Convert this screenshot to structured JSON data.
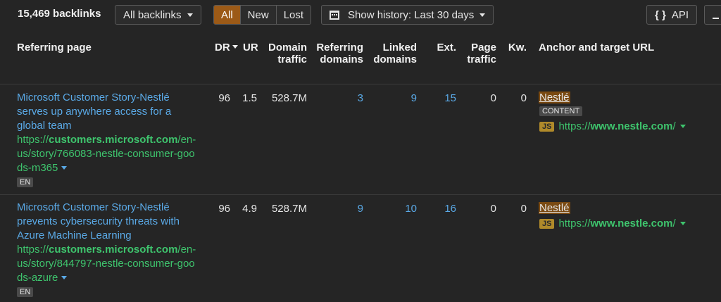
{
  "toolbar": {
    "count": "15,469 backlinks",
    "filter_label": "All backlinks",
    "seg_all": "All",
    "seg_new": "New",
    "seg_lost": "Lost",
    "history_label": "Show history: Last 30 days",
    "api_label": "API"
  },
  "header": {
    "referring_page": "Referring page",
    "dr": "DR",
    "ur": "UR",
    "domain_traffic_1": "Domain",
    "domain_traffic_2": "traffic",
    "ref_domains_1": "Referring",
    "ref_domains_2": "domains",
    "linked_domains_1": "Linked",
    "linked_domains_2": "domains",
    "ext": "Ext.",
    "page_traffic_1": "Page",
    "page_traffic_2": "traffic",
    "kw": "Kw.",
    "anchor": "Anchor and target URL"
  },
  "rows": [
    {
      "title_l1": "Microsoft Customer Story-Nestlé",
      "title_l2": "serves up anywhere access for a",
      "title_l3": "global team",
      "url_prefix": "https://",
      "url_domain": "customers.microsoft.com",
      "url_rest_l1": "/en-",
      "url_l2": "us/story/766083-nestle-consumer-goo",
      "url_l3": "ds-m365",
      "lang": "EN",
      "dr": "96",
      "ur": "1.5",
      "domain_traffic": "528.7M",
      "ref_domains": "3",
      "linked_domains": "9",
      "ext": "15",
      "page_traffic": "0",
      "kw": "0",
      "anchor": "Nestlé",
      "content_tag": "CONTENT",
      "js": "JS",
      "target_prefix": "https://",
      "target_domain": "www.nestle.com",
      "target_suffix": "/"
    },
    {
      "title_l1": "Microsoft Customer Story-Nestlé",
      "title_l2": "prevents cybersecurity threats with",
      "title_l3": "Azure Machine Learning",
      "url_prefix": "https://",
      "url_domain": "customers.microsoft.com",
      "url_rest_l1": "/en-",
      "url_l2": "us/story/844797-nestle-consumer-goo",
      "url_l3": "ds-azure",
      "lang": "EN",
      "dr": "96",
      "ur": "4.9",
      "domain_traffic": "528.7M",
      "ref_domains": "9",
      "linked_domains": "10",
      "ext": "16",
      "page_traffic": "0",
      "kw": "0",
      "anchor": "Nestlé",
      "js": "JS",
      "target_prefix": "https://",
      "target_domain": "www.nestle.com",
      "target_suffix": "/"
    }
  ]
}
